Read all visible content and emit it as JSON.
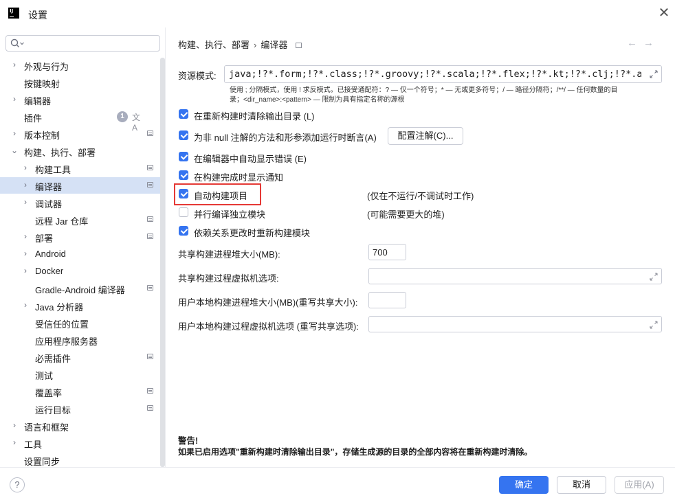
{
  "window": {
    "title": "设置",
    "close": "✕"
  },
  "search": {
    "placeholder": "",
    "value": ""
  },
  "sidebar": {
    "badge": "1",
    "items": [
      {
        "label": "外观与行为"
      },
      {
        "label": "按键映射"
      },
      {
        "label": "编辑器"
      },
      {
        "label": "插件"
      },
      {
        "label": "版本控制"
      },
      {
        "label": "构建、执行、部署"
      },
      {
        "label": "构建工具"
      },
      {
        "label": "编译器"
      },
      {
        "label": "调试器"
      },
      {
        "label": "远程 Jar 仓库"
      },
      {
        "label": "部署"
      },
      {
        "label": "Android"
      },
      {
        "label": "Docker"
      },
      {
        "label": "Gradle-Android 编译器"
      },
      {
        "label": "Java 分析器"
      },
      {
        "label": "受信任的位置"
      },
      {
        "label": "应用程序服务器"
      },
      {
        "label": "必需插件"
      },
      {
        "label": "测试"
      },
      {
        "label": "覆盖率"
      },
      {
        "label": "运行目标"
      },
      {
        "label": "语言和框架"
      },
      {
        "label": "工具"
      },
      {
        "label": "设置同步"
      }
    ]
  },
  "breadcrumb": {
    "parent": "构建、执行、部署",
    "sep": "›",
    "current": "编译器"
  },
  "nav": {
    "back": "←",
    "forward": "→"
  },
  "resource": {
    "label": "资源模式:",
    "value": "java;!?*.form;!?*.class;!?*.groovy;!?*.scala;!?*.flex;!?*.kt;!?*.clj;!?*.aj",
    "hint_line1": "使用 ; 分隔模式，使用 ! 求反模式。已接受通配符：? — 仅一个符号；* — 无或更多符号；/ — 路径分隔符；/**/ — 任何数量的目",
    "hint_line2": "录；<dir_name>:<pattern> — 限制为具有指定名称的源根"
  },
  "options": {
    "clear_output": "在重新构建时清除输出目录 (L)",
    "not_null_assert": "为非 null 注解的方法和形参添加运行时断言(A)",
    "configure_annotations": "配置注解(C)...",
    "auto_show_errors": "在编辑器中自动显示错误 (E)",
    "notify_on_finish": "在构建完成时显示通知",
    "auto_build": "自动构建项目",
    "auto_build_note": "(仅在不运行/不调试时工作)",
    "parallel": "并行编译独立模块",
    "parallel_note": "(可能需要更大的堆)",
    "rebuild_on_dep_change": "依赖关系更改时重新构建模块"
  },
  "heap": {
    "shared_heap_label": "共享构建进程堆大小(MB):",
    "shared_heap_value": "700",
    "shared_vm_label": "共享构建过程虚拟机选项:",
    "user_heap_label": "用户本地构建进程堆大小(MB)(重写共享大小):",
    "user_vm_label": "用户本地构建过程虚拟机选项 (重写共享选项):"
  },
  "warning": {
    "title": "警告!",
    "body": "如果已启用选项\"重新构建时清除输出目录\"，存储生成源的目录的全部内容将在重新构建时清除。"
  },
  "footer": {
    "help": "?",
    "ok": "确定",
    "cancel": "取消",
    "apply": "应用(A)"
  },
  "colors": {
    "accent": "#3574f0",
    "selection": "#d5e1f5",
    "highlight": "#e53935"
  }
}
